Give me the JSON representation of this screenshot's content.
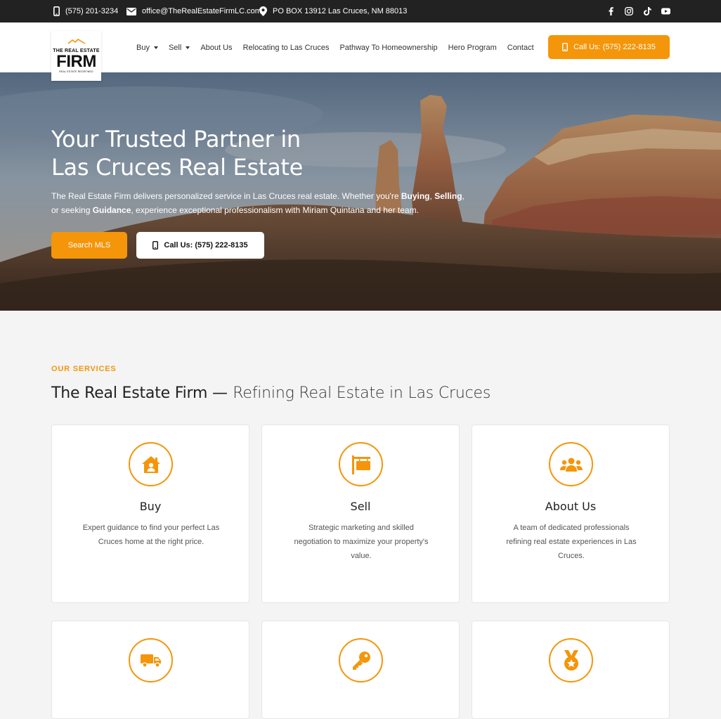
{
  "topbar": {
    "phone": "(575) 201-3234",
    "email": "office@TheRealEstateFirmLC.com",
    "address": "PO BOX 13912 Las Cruces, NM 88013",
    "social": [
      "facebook-icon",
      "instagram-icon",
      "tiktok-icon",
      "youtube-icon"
    ]
  },
  "logo": {
    "line1": "THE REAL ESTATE",
    "line2": "FIRM",
    "line3": "REAL ESTATE REDEFINED"
  },
  "nav": {
    "items": [
      "Buy",
      "Sell",
      "About Us",
      "Relocating to Las Cruces",
      "Pathway To Homeownership",
      "Hero Program",
      "Contact"
    ],
    "cta": "Call Us: (575) 222-8135"
  },
  "hero": {
    "title_line1": "Your Trusted Partner in",
    "title_line2": "Las Cruces Real Estate",
    "text_part1": "The Real Estate Firm delivers personalized service in Las Cruces real estate. Whether you're ",
    "text_bold1": "Buying",
    "text_part2": ", ",
    "text_bold2": "Selling",
    "text_part3": ", or seeking ",
    "text_bold3": "Guidance",
    "text_part4": ", experience exceptional professionalism with Miriam Quintana and her team.",
    "btn_search": "Search MLS",
    "btn_call": "Call Us: (575) 222-8135"
  },
  "services": {
    "eyebrow": "OUR SERVICES",
    "title_bold": "The Real Estate Firm —",
    "title_light": "Refining Real Estate in Las Cruces",
    "cards": [
      {
        "icon": "house-user-icon",
        "title": "Buy",
        "desc": "Expert guidance to find your perfect Las Cruces home at the right price."
      },
      {
        "icon": "sign-icon",
        "title": "Sell",
        "desc": "Strategic marketing and skilled negotiation to maximize your property's value."
      },
      {
        "icon": "users-icon",
        "title": "About Us",
        "desc": "A team of dedicated professionals refining real estate experiences in Las Cruces."
      },
      {
        "icon": "truck-icon",
        "title": "",
        "desc": ""
      },
      {
        "icon": "key-icon",
        "title": "",
        "desc": ""
      },
      {
        "icon": "medal-icon",
        "title": "",
        "desc": ""
      }
    ]
  },
  "colors": {
    "accent": "#f5950a",
    "topbar": "#222222",
    "page_bg": "#f4f4f4"
  }
}
